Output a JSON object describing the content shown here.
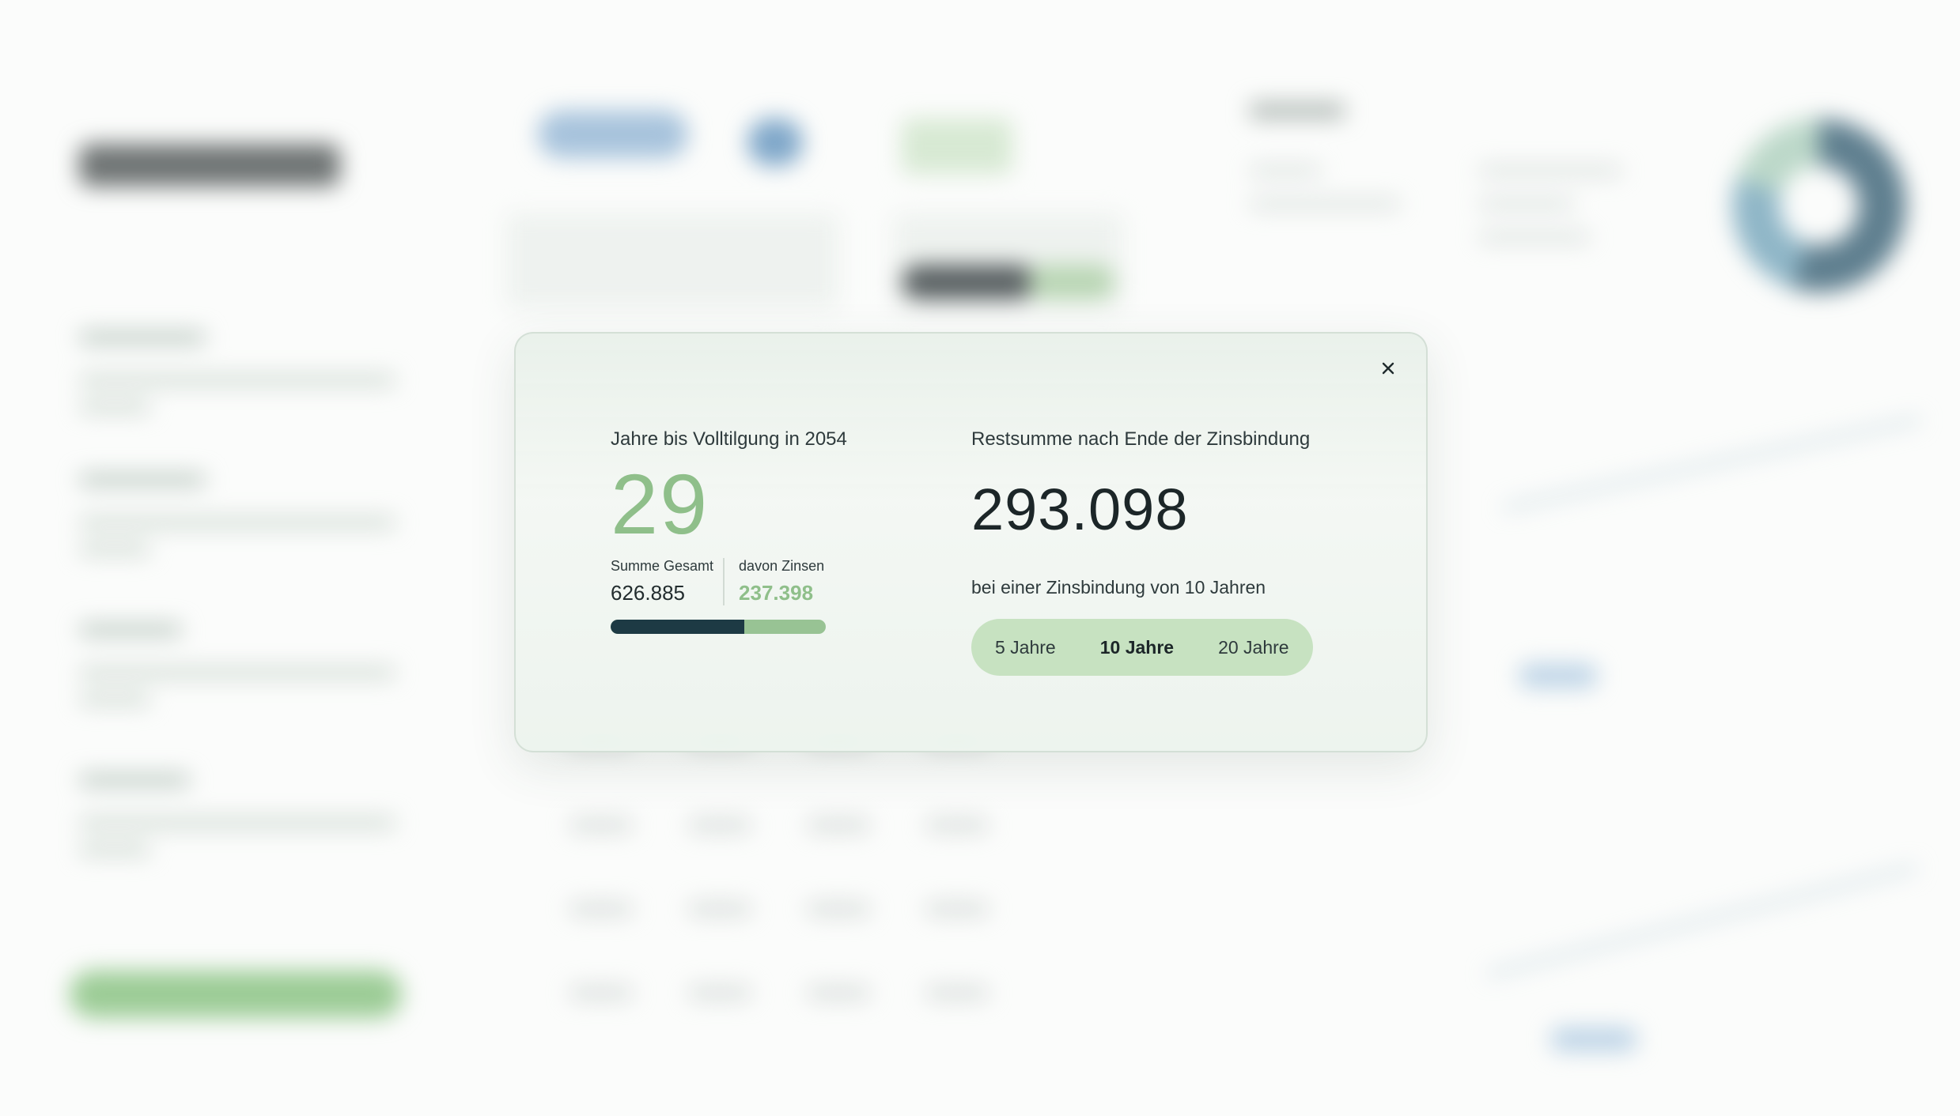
{
  "modal": {
    "left": {
      "label": "Jahre bis Volltilgung in 2054",
      "years": "29",
      "sum_total_label": "Summe Gesamt",
      "sum_total_value": "626.885",
      "interest_label": "davon Zinsen",
      "interest_value": "237.398",
      "principal_share_fraction": 0.62
    },
    "right": {
      "label": "Restsumme nach Ende der Zinsbindung",
      "remaining": "293.098",
      "subtext": "bei einer Zinsbindung von 10 Jahren",
      "options": [
        {
          "label": "5 Jahre",
          "active": false
        },
        {
          "label": "10 Jahre",
          "active": true
        },
        {
          "label": "20 Jahre",
          "active": false
        }
      ]
    },
    "close_icon": "close-icon"
  },
  "colors": {
    "accent_green": "#8fbf8a",
    "progress_dark": "#1d3a44",
    "segment_bg": "#c7e2c1"
  }
}
